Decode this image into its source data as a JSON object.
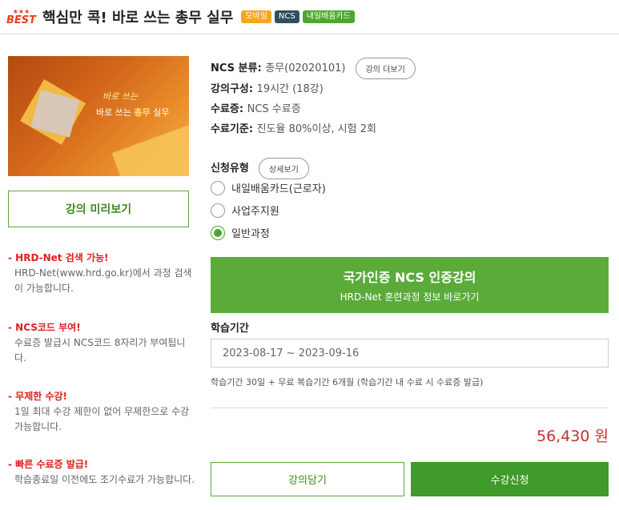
{
  "header": {
    "best_stars": "★★★",
    "best_label": "BEST",
    "title": "핵심만 콕! 바로 쓰는 총무 실무",
    "badges": [
      "모바일",
      "NCS",
      "내일배움카드"
    ]
  },
  "thumbnail": {
    "cursive_text": "바로 쓰는",
    "caption_prefix": "바로 쓰는 ",
    "caption_bold": "총무",
    "caption_suffix": " 실무"
  },
  "preview_button": "강의 미리보기",
  "features": [
    {
      "title": "- HRD-Net 검색 가능!",
      "desc": "HRD-Net(www.hrd.go.kr)에서 과정 검색이 가능합니다."
    },
    {
      "title": "- NCS코드 부여!",
      "desc": "수료증 발급시 NCS코드 8자리가 부여됩니다."
    },
    {
      "title": "- 무제한 수강!",
      "desc": "1일 최대 수강 제한이 없어 무제한으로 수강 가능합니다."
    },
    {
      "title": "- 빠른 수료증 발급!",
      "desc": "학습종료일 이전에도 조기수료가 가능합니다."
    }
  ],
  "info": {
    "ncs_key": "NCS 분류",
    "ncs_value": "총무(02020101)",
    "more_button": "강의 더보기",
    "compose_key": "강의구성",
    "compose_value": "19시간 (18강)",
    "cert_key": "수료증",
    "cert_value": "NCS 수료증",
    "criteria_key": "수료기준",
    "criteria_value": "진도율 80%이상, 시험 2회"
  },
  "apply_type": {
    "label": "신청유형",
    "detail_button": "상세보기",
    "options": [
      "내일배움카드(근로자)",
      "사업주지원",
      "일반과정"
    ],
    "selected_index": 2
  },
  "ncs_banner": {
    "line1": "국가인증 NCS 인증강의",
    "line2": "HRD-Net 훈련과정 정보 바로가기"
  },
  "period": {
    "label": "학습기간",
    "value": "2023-08-17 ~ 2023-09-16",
    "note": "학습기간 30일 + 무료 복습기간 6개월 (학습기간 내 수료 시 수료증 발급)"
  },
  "price": "56,430 원",
  "buttons": {
    "cart": "강의담기",
    "apply": "수강신청"
  },
  "colors": {
    "accent_green": "#5aab3a",
    "apply_green": "#3f9b2a",
    "price_red": "#c9302c",
    "feature_red": "#e02020"
  }
}
